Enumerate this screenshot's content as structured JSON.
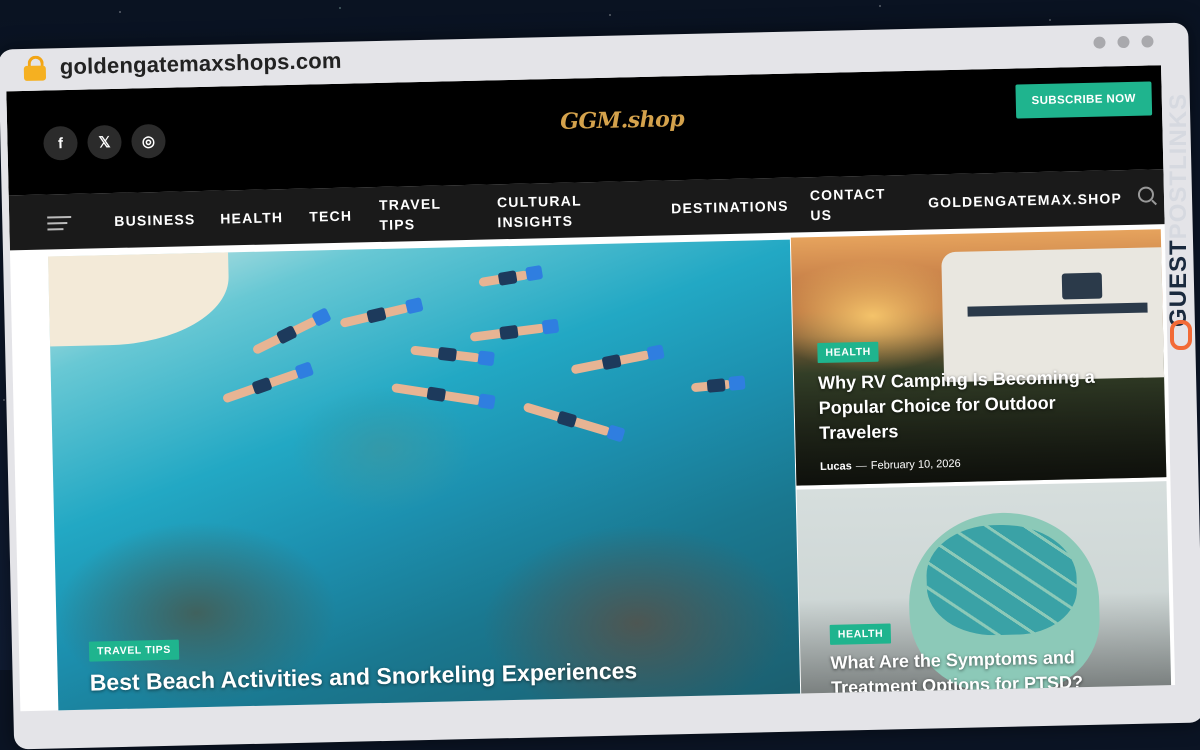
{
  "browser": {
    "url": "goldengatemaxshops.com"
  },
  "header": {
    "social": [
      {
        "name": "facebook-icon",
        "glyph": "f"
      },
      {
        "name": "x-icon",
        "glyph": "𝕏"
      },
      {
        "name": "instagram-icon",
        "glyph": "◎"
      }
    ],
    "logo": "GGM.shop",
    "subscribe_label": "SUBSCRIBE NOW"
  },
  "nav": {
    "items": [
      "BUSINESS",
      "HEALTH",
      "TECH",
      "TRAVEL TIPS",
      "CULTURAL INSIGHTS",
      "DESTINATIONS",
      "CONTACT US",
      "GOLDENGATEMAX.SHOP"
    ]
  },
  "hero": {
    "category": "TRAVEL TIPS",
    "title": "Best Beach Activities and Snorkeling Experiences"
  },
  "side_posts": [
    {
      "category": "HEALTH",
      "title": "Why RV Camping Is Becoming a Popular Choice for Outdoor Travelers",
      "author": "Lucas",
      "separator": "—",
      "date": "February 10, 2026"
    },
    {
      "category": "HEALTH",
      "title": "What Are the Symptoms and Treatment Options for PTSD?"
    }
  ],
  "watermark": {
    "part1": "GUEST",
    "part2": "POSTLINKS"
  },
  "colors": {
    "accent": "#1fb48e",
    "nav_bg": "#1a1a1a",
    "top_bg": "#000000",
    "logo": "#d4a24c"
  }
}
